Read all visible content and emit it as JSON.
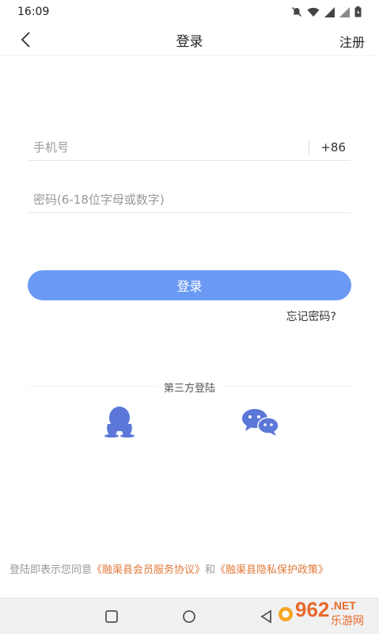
{
  "status_bar": {
    "time": "16:09"
  },
  "nav": {
    "title": "登录",
    "register_label": "注册"
  },
  "form": {
    "phone_placeholder": "手机号",
    "country_code": "+86",
    "password_placeholder": "密码(6-18位字母或数字)",
    "login_label": "登录",
    "forgot_label": "忘记密码?"
  },
  "third_party": {
    "label": "第三方登陆",
    "providers": [
      "qq-icon",
      "wechat-icon"
    ]
  },
  "agreement": {
    "prefix": "登陆即表示您同意",
    "member_link": "《融渠县会员服务协议》",
    "and": "和",
    "privacy_link": "《融渠县隐私保护政策》"
  },
  "watermark": {
    "brand": "962",
    "suffix": ".NET",
    "sub": "乐游网"
  },
  "colors": {
    "primary": "#6b9af4",
    "link": "#e07a3a",
    "icon_blue": "#5b78d8"
  }
}
